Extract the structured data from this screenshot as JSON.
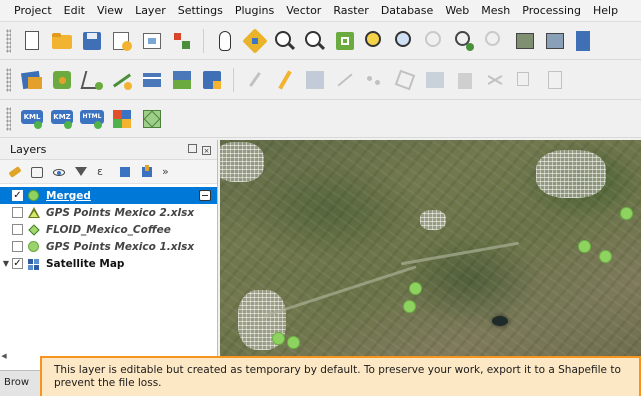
{
  "menubar": {
    "items": [
      "Project",
      "Edit",
      "View",
      "Layer",
      "Settings",
      "Plugins",
      "Vector",
      "Raster",
      "Database",
      "Web",
      "Mesh",
      "Processing",
      "Help"
    ]
  },
  "toolbar3": {
    "kml_label": "KML",
    "kmz_label": "KMZ",
    "html_label": "HTML"
  },
  "layers_panel": {
    "title": "Layers",
    "layers": [
      {
        "name": "Merged",
        "checked": true,
        "symbol": "circle-green",
        "selected": true,
        "editable": true
      },
      {
        "name": "GPS Points Mexico 2.xlsx",
        "checked": false,
        "symbol": "triangle-green"
      },
      {
        "name": "FLOID_Mexico_Coffee",
        "checked": false,
        "symbol": "diamond-green"
      },
      {
        "name": "GPS Points Mexico 1.xlsx",
        "checked": false,
        "symbol": "circle-green"
      },
      {
        "name": "Satellite Map",
        "checked": true,
        "symbol": "raster-icon",
        "expandable": true
      }
    ],
    "checkmark": "✓",
    "expander": "▼",
    "more_glyph": "»"
  },
  "browser_tab": {
    "label": "Brow"
  },
  "notice": {
    "text": "This layer is editable but created as temporary by default. To preserve your work, export it to a Shapefile to prevent the file loss."
  },
  "colors": {
    "selection": "#0078d7",
    "point_fill": "#8ed35f",
    "notice_bg": "#fde8c6",
    "notice_border": "#f7941d"
  }
}
